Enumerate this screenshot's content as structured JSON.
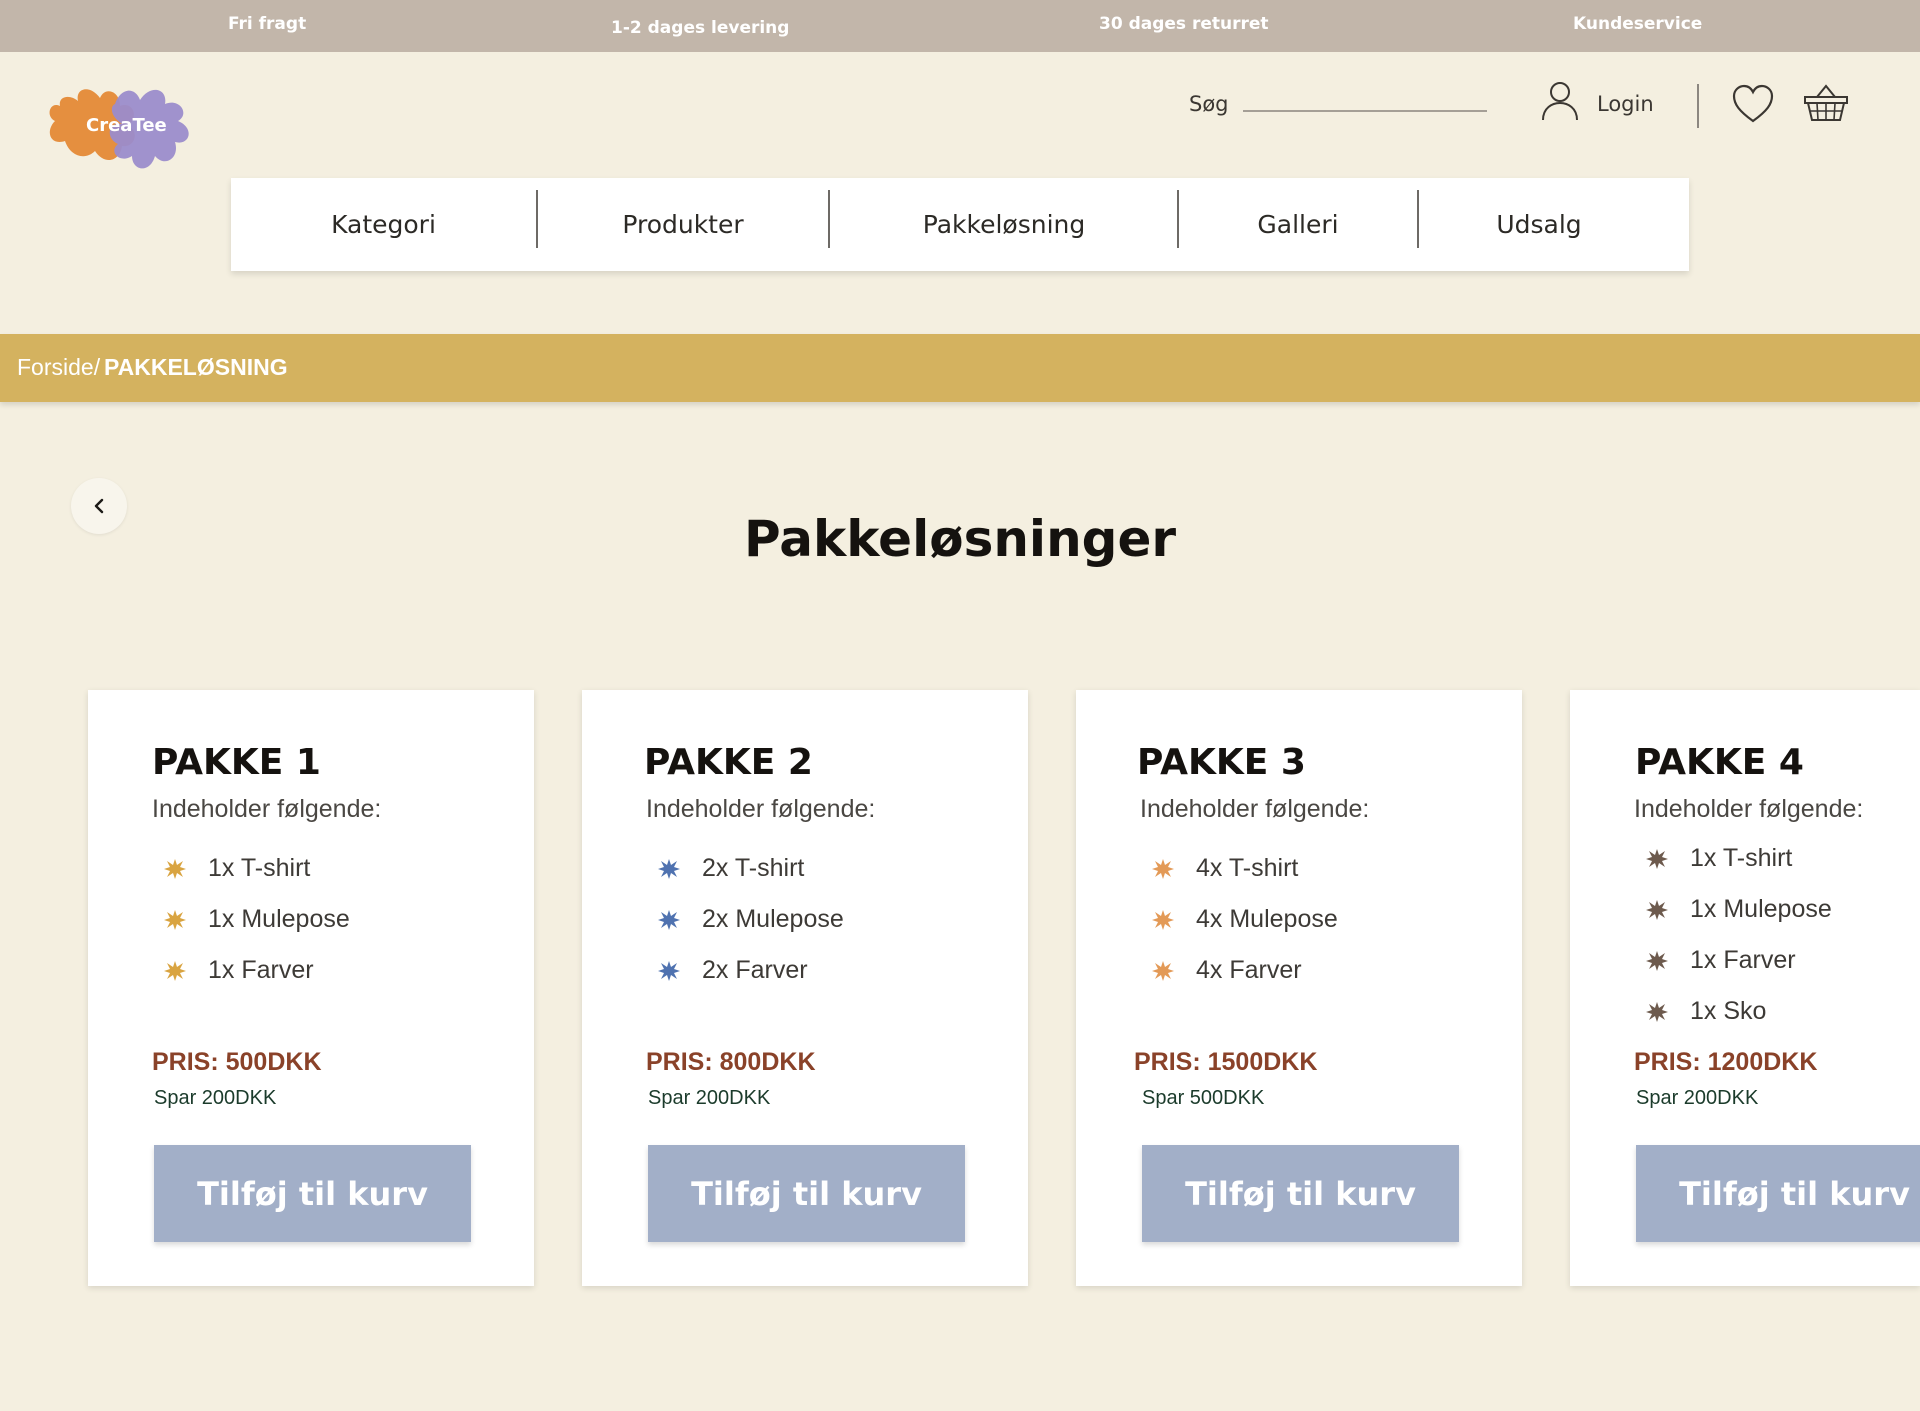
{
  "topbar": {
    "items": [
      "Fri fragt",
      "1-2 dages levering",
      "30 dages returret",
      "Kundeservice"
    ]
  },
  "logo": {
    "text": "CreaTee"
  },
  "header": {
    "search_label": "Søg",
    "login_label": "Login"
  },
  "nav": {
    "items": [
      "Kategori",
      "Produkter",
      "Pakkeløsning",
      "Galleri",
      "Udsalg"
    ]
  },
  "breadcrumb": {
    "home": "Forside/",
    "current": "PAKKELØSNING"
  },
  "main": {
    "title": "Pakkeløsninger"
  },
  "cards": [
    {
      "title": "PAKKE 1",
      "subtitle": "Indeholder følgende:",
      "items": [
        "1x T-shirt",
        "1x Mulepose",
        "1x Farver"
      ],
      "price": "PRIS: 500DKK",
      "save": "Spar 200DKK",
      "button": "Tilføj til kurv",
      "bullet_color": "#d9a441"
    },
    {
      "title": "PAKKE 2",
      "subtitle": "Indeholder følgende:",
      "items": [
        "2x T-shirt",
        "2x Mulepose",
        "2x Farver"
      ],
      "price": "PRIS: 800DKK",
      "save": "Spar 200DKK",
      "button": "Tilføj til kurv",
      "bullet_color": "#4f72b0"
    },
    {
      "title": "PAKKE 3",
      "subtitle": "Indeholder følgende:",
      "items": [
        "4x T-shirt",
        "4x Mulepose",
        "4x Farver"
      ],
      "price": "PRIS: 1500DKK",
      "save": "Spar 500DKK",
      "button": "Tilføj til kurv",
      "bullet_color": "#e39a57"
    },
    {
      "title": "PAKKE 4",
      "subtitle": "Indeholder følgende:",
      "items": [
        "1x T-shirt",
        "1x Mulepose",
        "1x Farver",
        "1x Sko"
      ],
      "price": "PRIS: 1200DKK",
      "save": "Spar 200DKK",
      "button": "Tilføj til kurv",
      "bullet_color": "#6d5a4d"
    }
  ],
  "colors": {
    "background": "#f4efe0",
    "topbar": "#c2b6aa",
    "breadcrumb": "#d4b25f",
    "button": "#a2afc8",
    "price": "#8a4229"
  }
}
